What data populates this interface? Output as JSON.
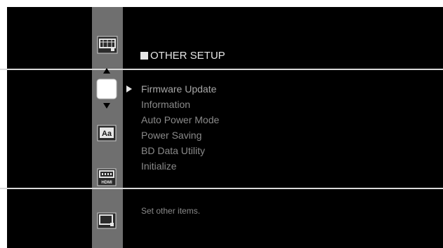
{
  "section_title": "OTHER SETUP",
  "menu": {
    "selected_index": 0,
    "items": [
      {
        "label": "Firmware Update"
      },
      {
        "label": "Information"
      },
      {
        "label": "Auto Power Mode"
      },
      {
        "label": "Power Saving"
      },
      {
        "label": "BD Data Utility"
      },
      {
        "label": "Initialize"
      }
    ]
  },
  "description": "Set other items.",
  "sidebar": {
    "icons": [
      "picture-setup-icon",
      "other-setup-icon",
      "language-setup-icon",
      "hdmi-setup-icon",
      "network-setup-icon"
    ],
    "hdmi_icon_label": "HDMI",
    "language_icon_label": "Aa"
  },
  "colors": {
    "background": "#000000",
    "sidebar": "#6f6f6f",
    "divider": "#d9d9d9",
    "menu_text": "#8a8a8a",
    "title_text": "#e6e6e6"
  }
}
